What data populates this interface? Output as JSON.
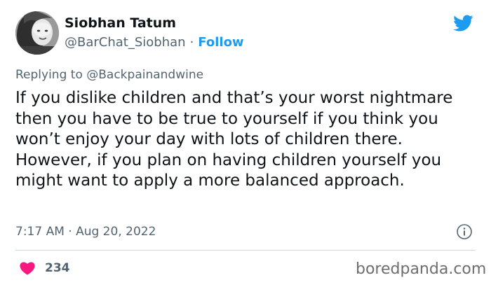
{
  "tweet": {
    "author": {
      "display_name": "Siobhan Tatum",
      "handle": "@BarChat_Siobhan",
      "separator": "·",
      "follow_label": "Follow"
    },
    "replying_prefix": "Replying to",
    "replying_to": "@Backpainandwine",
    "text": "If you dislike children and that’s your worst nightmare then you have to be true to yourself if you think you won’t enjoy your day with lots of children there. However, if you plan on having children yourself you might want to apply a more balanced approach.",
    "timestamp": "7:17 AM · Aug 20, 2022",
    "like_count": "234",
    "icons": {
      "platform": "twitter-bird-icon",
      "info": "info-icon",
      "like": "heart-icon"
    },
    "colors": {
      "accent": "#1d9bf0",
      "secondary_text": "#536471",
      "heart": "#f91880"
    }
  },
  "watermark": "boredpanda.com"
}
